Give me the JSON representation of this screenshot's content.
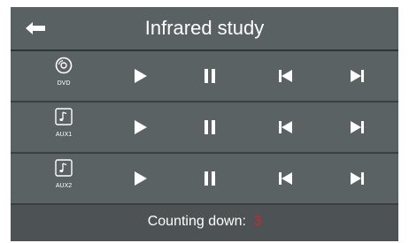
{
  "header": {
    "title": "Infrared study",
    "back_icon": "arrow-left-icon"
  },
  "devices": [
    {
      "label": "DVD",
      "icon": "disc-icon"
    },
    {
      "label": "AUX1",
      "icon": "music-note-icon"
    },
    {
      "label": "AUX2",
      "icon": "music-note-icon"
    }
  ],
  "controls": [
    "play-icon",
    "pause-icon",
    "previous-icon",
    "next-icon"
  ],
  "footer": {
    "countdown_label": "Counting down:",
    "countdown_value": "3"
  },
  "colors": {
    "background": "#4d5354",
    "row": "#5b6263",
    "icon": "#ffffff",
    "countdown_value": "#e02020"
  }
}
